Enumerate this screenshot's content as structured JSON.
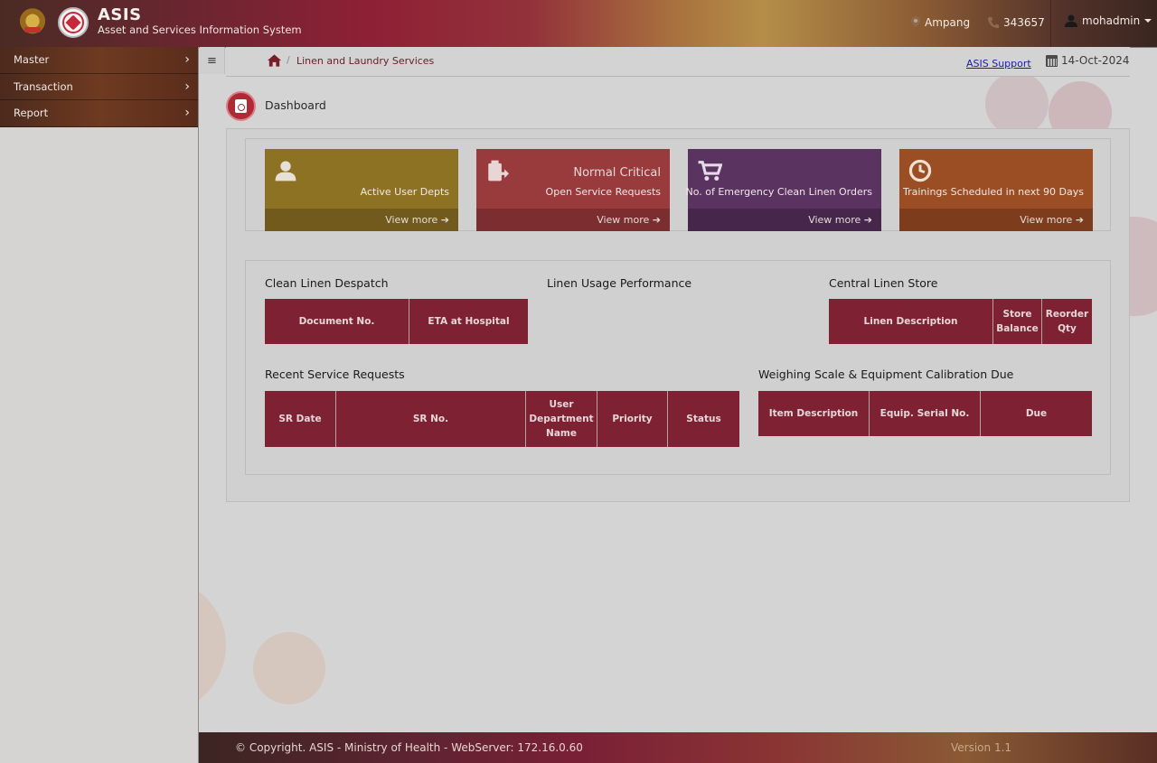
{
  "header": {
    "app_name": "ASIS",
    "app_subtitle": "Asset and Services Information System",
    "location": "Ampang",
    "phone": "343657",
    "username": "mohadmin"
  },
  "sidebar": {
    "items": [
      {
        "label": "Master"
      },
      {
        "label": "Transaction"
      },
      {
        "label": "Report"
      }
    ]
  },
  "breadcrumb": {
    "current": "Linen and Laundry Services",
    "separator": "/",
    "support_link": "ASIS Support",
    "date": "14-Oct-2024"
  },
  "page": {
    "title": "Dashboard"
  },
  "tiles": [
    {
      "icon": "user-icon",
      "value": "",
      "label": "Active User Depts",
      "link": "View more",
      "color": "#8e7223"
    },
    {
      "icon": "clipboard-icon",
      "value": "Normal Critical",
      "label": "Open Service Requests",
      "link": "View more",
      "color": "#993a3c"
    },
    {
      "icon": "cart-icon",
      "value": "",
      "label": "No. of Emergency Clean Linen Orders",
      "link": "View more",
      "color": "#5a3361"
    },
    {
      "icon": "clock-icon",
      "value": "",
      "label": "Trainings Scheduled in next 90 Days",
      "link": "View more",
      "color": "#9b4d24"
    }
  ],
  "sections": {
    "despatch": {
      "title": "Clean Linen Despatch",
      "columns": [
        "Document No.",
        "ETA at Hospital"
      ]
    },
    "usage": {
      "title": "Linen Usage Performance"
    },
    "store": {
      "title": "Central Linen Store",
      "columns": [
        "Linen Description",
        "Store Balance",
        "Reorder Qty"
      ]
    },
    "service_requests": {
      "title": "Recent Service Requests",
      "columns": [
        "SR Date",
        "SR No.",
        "User Department Name",
        "Priority",
        "Status"
      ]
    },
    "calibration": {
      "title": "Weighing Scale & Equipment Calibration Due",
      "columns": [
        "Item Description",
        "Equip. Serial No.",
        "Due"
      ]
    }
  },
  "footer": {
    "copyright": "© Copyright. ASIS - Ministry of Health - WebServer: 172.16.0.60",
    "version": "Version 1.1"
  },
  "colors": {
    "accent": "#7e2132",
    "header_bar": "#8e2035"
  }
}
